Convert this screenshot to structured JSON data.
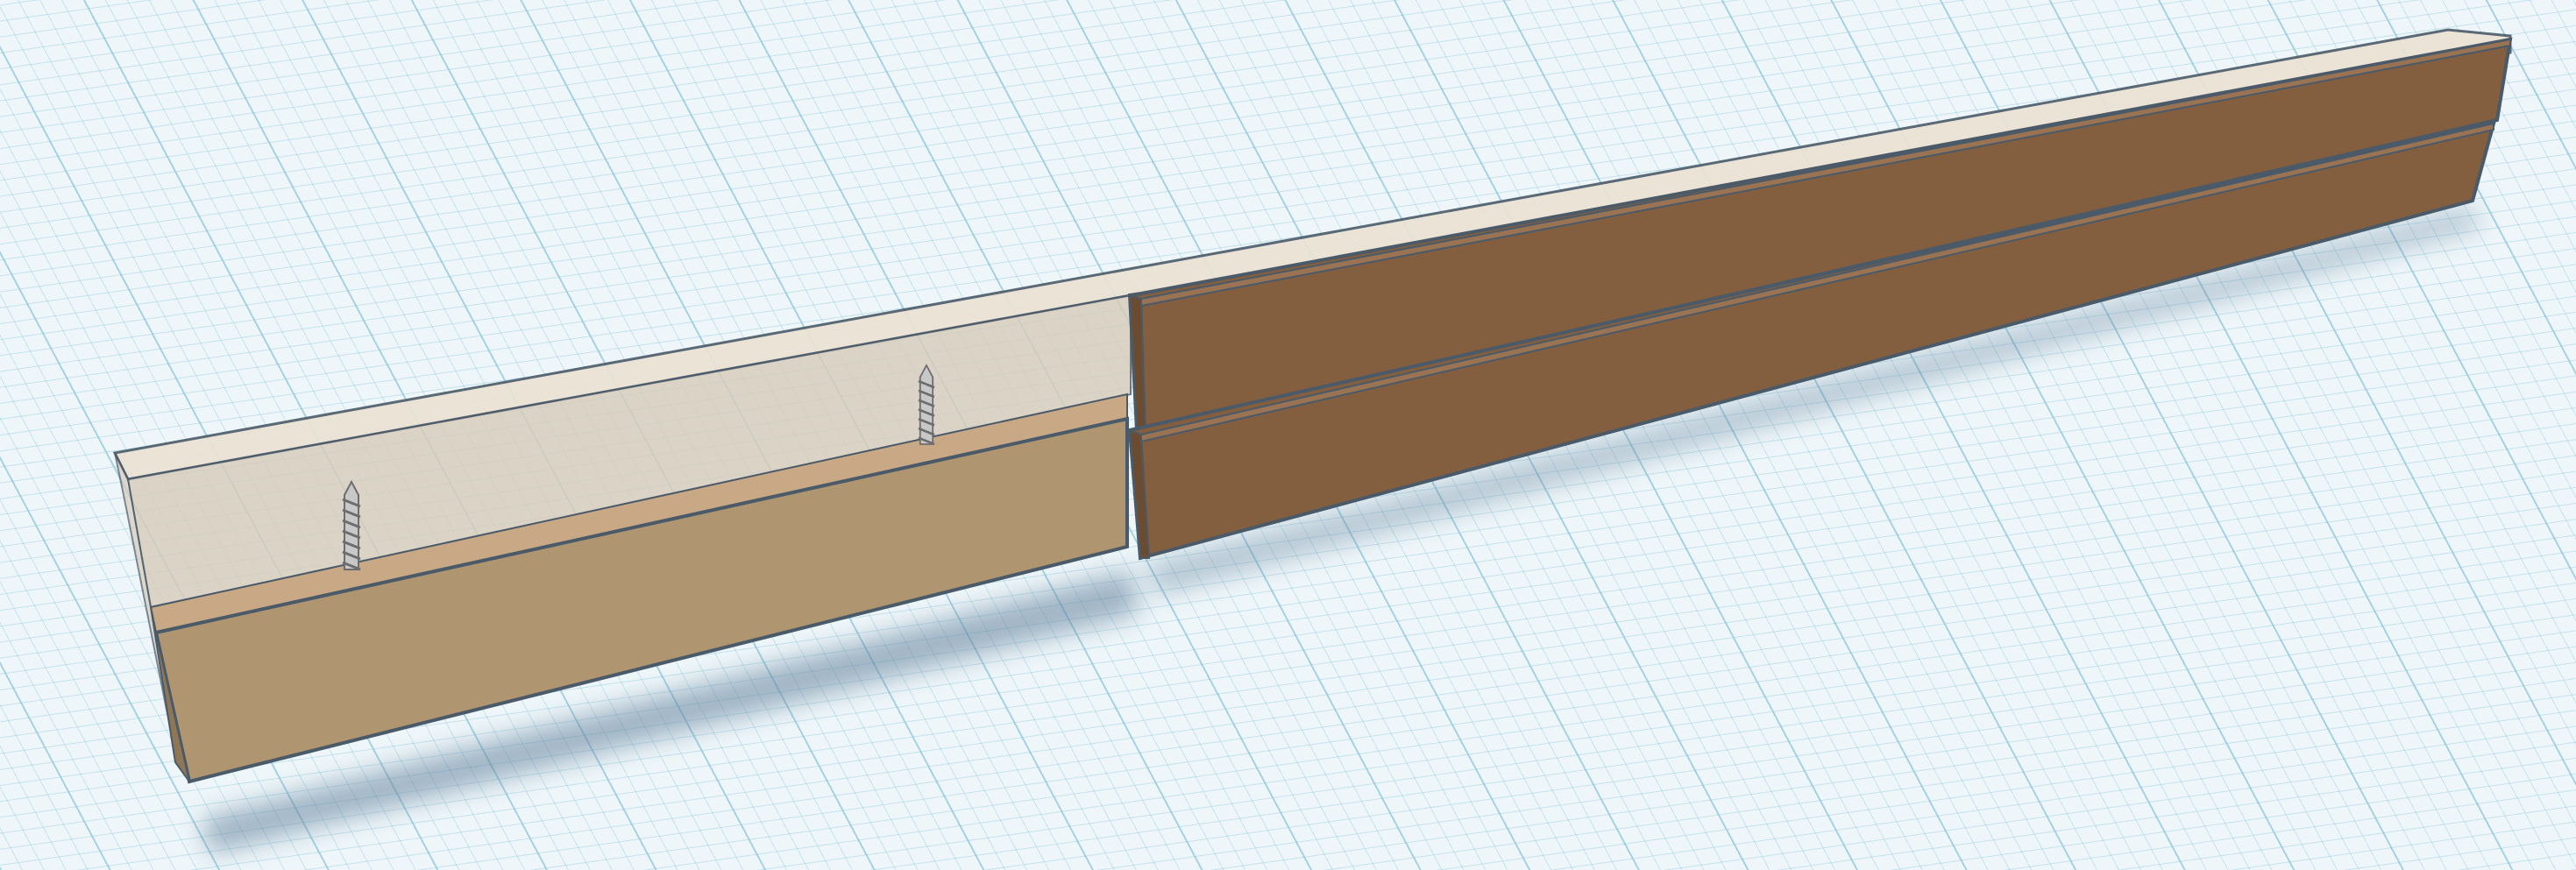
{
  "app": {
    "view": "3d-workplane"
  },
  "colors": {
    "workplane": "#eef6f9",
    "grid": "#8cc7dc",
    "light_wood_front": "#b09571",
    "light_wood_top": "#c9a985",
    "dark_wood": "#835f3f",
    "transparent_box": "#e9dfd2",
    "edge": "#4a5a68"
  },
  "objects": [
    {
      "name": "transparent-hole-box"
    },
    {
      "name": "light-wood-board"
    },
    {
      "name": "dark-wood-board-upper"
    },
    {
      "name": "dark-wood-board-lower"
    },
    {
      "name": "screw-1"
    },
    {
      "name": "screw-2"
    }
  ]
}
